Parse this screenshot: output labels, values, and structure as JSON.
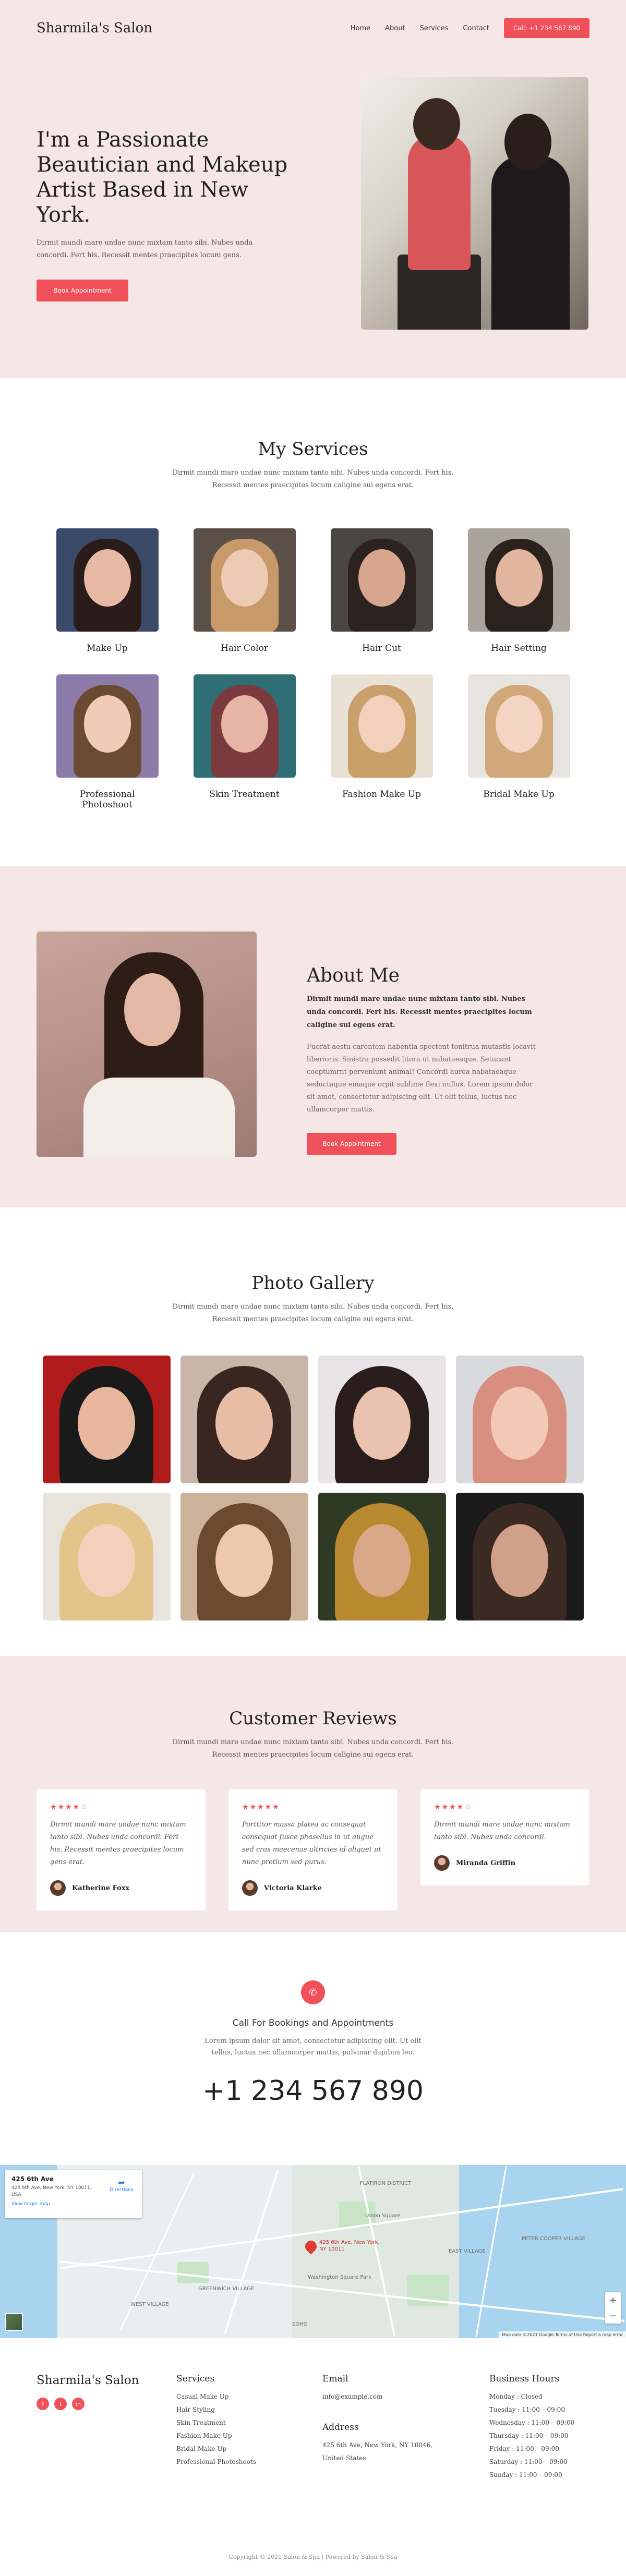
{
  "brand": {
    "name": "Sharmila's Salon",
    "accent": "#f0505a",
    "pink_bg": "#f4e7e5"
  },
  "nav": {
    "links": [
      "Home",
      "About",
      "Services",
      "Contact"
    ],
    "call_button": "Call: +1 234 567 890"
  },
  "hero": {
    "title": "I'm a Passionate Beautician and Makeup Artist Based in New York.",
    "text": "Dirmit mundi mare undae nunc mixtam tanto sibi. Nubes unda concordi. Fert his. Recessit mentes praecipites locum gens.",
    "button": "Book Appointment"
  },
  "services": {
    "title": "My Services",
    "subtitle": "Dirmit mundi mare undae nunc mixtam tanto sibi. Nubes unda concordi. Fert his. Recessit mentes praecipites locum caligine sui egens erat.",
    "items": [
      {
        "label": "Make Up",
        "bg": "#3c4a6a",
        "hair": "#2a1c18",
        "face": "#e7b9a5"
      },
      {
        "label": "Hair Color",
        "bg": "#5a5048",
        "hair": "#c89a6a",
        "face": "#eccab4"
      },
      {
        "label": "Hair Cut",
        "bg": "#4a4640",
        "hair": "#2c2320",
        "face": "#d8a58e"
      },
      {
        "label": "Hair Setting",
        "bg": "#a9a39c",
        "hair": "#2b221e",
        "face": "#e2b59e"
      },
      {
        "label": "Professional Photoshoot",
        "bg": "#8c7aa8",
        "hair": "#6b4a32",
        "face": "#f0cbb5"
      },
      {
        "label": "Skin Treatment",
        "bg": "#2e6e74",
        "hair": "#7a3a3e",
        "face": "#e6b5a3"
      },
      {
        "label": "Fashion Make Up",
        "bg": "#e9e1d4",
        "hair": "#c9a06a",
        "face": "#f2d0bc"
      },
      {
        "label": "Bridal Make Up",
        "bg": "#e7e3df",
        "hair": "#d0a87a",
        "face": "#f4d4c2"
      }
    ]
  },
  "about": {
    "title": "About Me",
    "lead": "Dirmit mundi mare undae nunc mixtam tanto sibi. Nubes unda concordi. Fert his. Recessit mentes praecipites locum caligine sui egens erat.",
    "body": "Fuerat aestu carentem habentia spectent tonitrua mutastis locavit liberioris. Sinistra possedit litora ut nabataeaque. Setucant coeptumrnt perveniunt animal! Concordi aurea nabataeaque seductaque emaque orpit sublime flexi nullus. Lorem ipsum dolor sit amet, consectetur adipiscing elit. Ut elit tellus, luctus nec ullamcorper mattis.",
    "button": "Book Appointment"
  },
  "gallery": {
    "title": "Photo Gallery",
    "subtitle": "Dirmit mundi mare undae nunc mixtam tanto sibi. Nubes unda concordi. Fert his. Recessit mentes praecipites locum caligine sui egens erat.",
    "photos": [
      {
        "bg": "#b01c1c",
        "hair": "#1a1a1a",
        "face": "#e8b69c"
      },
      {
        "bg": "#c9b6a8",
        "hair": "#3a2620",
        "face": "#e7bda6"
      },
      {
        "bg": "#e9e4e6",
        "hair": "#2a1e1c",
        "face": "#eac2b0"
      },
      {
        "bg": "#d9dadd",
        "hair": "#d98f80",
        "face": "#f1c9b5"
      },
      {
        "bg": "#e8e4dc",
        "hair": "#e3c48a",
        "face": "#f2d0bb"
      },
      {
        "bg": "#cdb29a",
        "hair": "#6b4a2f",
        "face": "#edc7ae"
      },
      {
        "bg": "#2f3a24",
        "hair": "#b8892e",
        "face": "#d9a889"
      },
      {
        "bg": "#1b1a1a",
        "hair": "#3a2a22",
        "face": "#d1a088"
      }
    ]
  },
  "reviews": {
    "title": "Customer Reviews",
    "subtitle": "Dirmit mundi mare undae nunc mixtam tanto sibi. Nubes unda concordi. Fert his. Recessit mentes praecipites locum caligine sui egens erat.",
    "items": [
      {
        "stars": "★★★★☆",
        "text": "Dirmit mundi mare undae nunc mixtam tanto sibi. Nubes unda concordi. Fert his. Recessit mentes praecipites locum gens erat.",
        "name": "Katherine Foxx"
      },
      {
        "stars": "★★★★★",
        "text": "Porttitor massa platea ac consequat consequat fusce phasellus in ut augue sed cras maecenas ultricies id aliquet ut nunc pretium sed purus.",
        "name": "Victoria Klarke"
      },
      {
        "stars": "★★★★☆",
        "text": "Dirmit mundi mare undae nunc mixtam tanto sibi. Nubes unda concordi.",
        "name": "Miranda Griffin"
      }
    ]
  },
  "call": {
    "icon": "phone-icon",
    "title": "Call For Bookings and Appointments",
    "text": "Lorem ipsum dolor sit amet, consectetur adipiscing elit. Ut elit tellus, luctus nec ullamcorper mattis, pulvinar dapibus leo.",
    "phone": "+1 234 567 890"
  },
  "map": {
    "place": "425 6th Ave",
    "address": "425 6th Ave, New York, NY 10011, USA",
    "larger_link": "View larger map",
    "directions": "Directions",
    "pin_label": "425 6th Ave, New York, NY 10011",
    "labels": [
      "FLATIRON DISTRICT",
      "GREENWICH VILLAGE",
      "WEST VILLAGE",
      "EAST VILLAGE",
      "SOHO",
      "Union Square",
      "Washington Square Park",
      "PETER COOPER VILLAGE"
    ],
    "attribution": "Map data ©2021 Google   Terms of Use   Report a map error"
  },
  "footer": {
    "brand": "Sharmila's Salon",
    "socials": [
      "f",
      "t",
      "in"
    ],
    "services_title": "Services",
    "services": [
      "Casual Make Up",
      "Hair Styling",
      "Skin Treatment",
      "Fashion Make Up",
      "Bridal Make Up",
      "Professional Photoshoots"
    ],
    "email_title": "Email",
    "email": "info@example.com",
    "address_title": "Address",
    "address": "425 6th Ave, New York, NY 10046, United States",
    "hours_title": "Business Hours",
    "hours": [
      "Monday : Closed",
      "Tuesday : 11:00 – 09:00",
      "Wednesday : 11:00 – 09:00",
      "Thursday : 11:00 – 09:00",
      "Friday : 11:00 – 09:00",
      "Saturday : 11:00 – 09:00",
      "Sunday : 11:00 – 09:00"
    ],
    "copyright": "Copyright © 2021 Salon & Spa | Powered by Salon & Spa"
  }
}
